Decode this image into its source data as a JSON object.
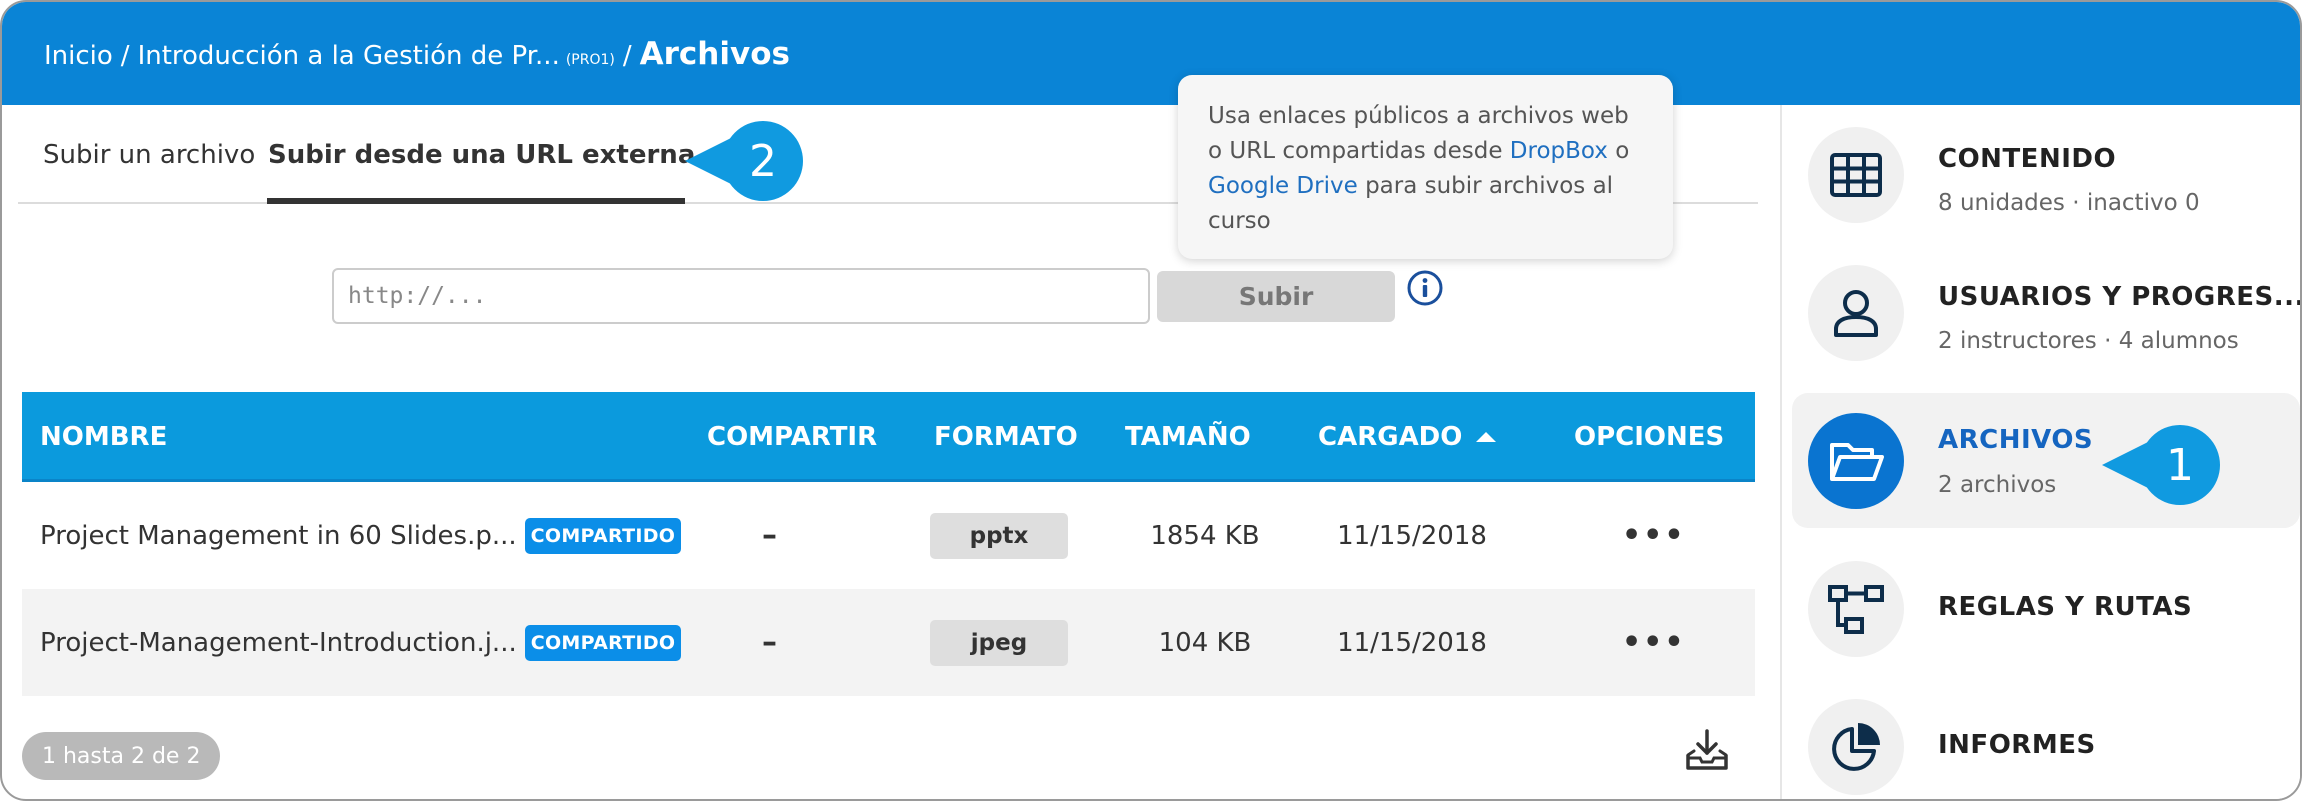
{
  "header": {
    "crumb_home": "Inicio",
    "crumb_sep": "/",
    "crumb_course": "Introducción a la Gestión de Pr...",
    "crumb_course_code": "(PRO1)",
    "crumb_current": "Archivos"
  },
  "tabs": [
    {
      "label": "Subir un archivo"
    },
    {
      "label": "Subir desde una URL externa"
    }
  ],
  "callouts": {
    "one": "1",
    "two": "2"
  },
  "url_upload": {
    "placeholder": "http://...",
    "button_label": "Subir",
    "info_icon": "info-circle-icon"
  },
  "tooltip": {
    "text_a": "Usa enlaces públicos a archivos web o URL compartidas desde",
    "link_dropbox": "DropBox",
    "text_b": "o",
    "link_gdrive": "Google Drive",
    "text_c": "para subir archivos al curso"
  },
  "table": {
    "headers": {
      "name": "NOMBRE",
      "share": "COMPARTIR",
      "format": "FORMATO",
      "size": "TAMAÑO",
      "loaded": "CARGADO",
      "options": "OPCIONES"
    },
    "rows": [
      {
        "name": "Project Management in 60 Slides.p...",
        "badge": "COMPARTIDO",
        "share": "–",
        "format": "pptx",
        "size": "1854 KB",
        "loaded": "11/15/2018",
        "options": "•••"
      },
      {
        "name": "Project-Management-Introduction.j...",
        "badge": "COMPARTIDO",
        "share": "–",
        "format": "jpeg",
        "size": "104 KB",
        "loaded": "11/15/2018",
        "options": "•••"
      }
    ]
  },
  "pager": {
    "label": "1 hasta 2 de 2"
  },
  "sidebar": {
    "items": [
      {
        "title": "CONTENIDO",
        "subtitle": "8 unidades · inactivo 0",
        "icon": "grid-icon"
      },
      {
        "title": "USUARIOS Y PROGRES...",
        "subtitle": "2 instructores · 4 alumnos",
        "icon": "user-icon"
      },
      {
        "title": "ARCHIVOS",
        "subtitle": "2 archivos",
        "icon": "folder-open-icon",
        "active": true
      },
      {
        "title": "REGLAS Y RUTAS",
        "subtitle": "",
        "icon": "flow-icon"
      },
      {
        "title": "INFORMES",
        "subtitle": "",
        "icon": "pie-chart-icon"
      }
    ]
  },
  "colors": {
    "header_bg": "#0a84d6",
    "table_header_bg": "#0b9add",
    "badge_bg": "#0b8ee8",
    "callout_bg": "#109ae0",
    "active_icon_bg": "#0a74d0"
  }
}
